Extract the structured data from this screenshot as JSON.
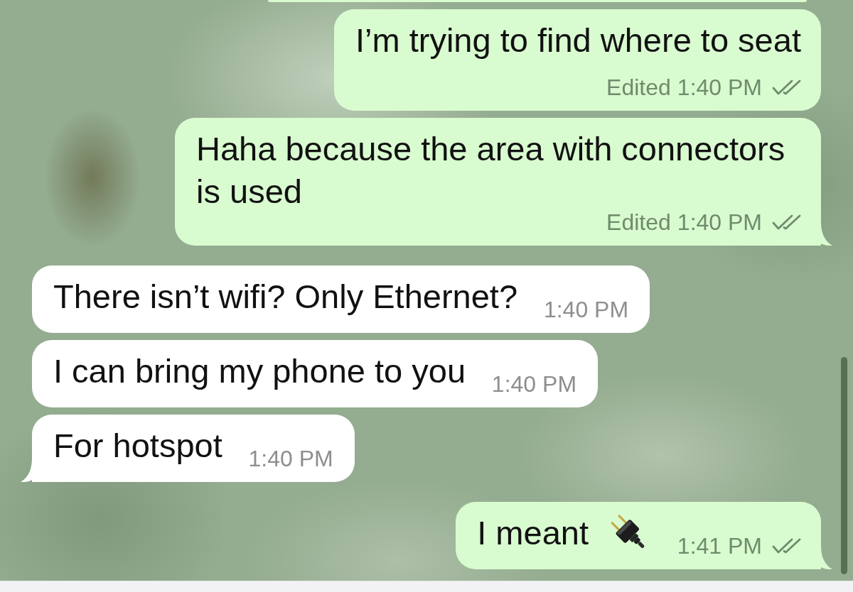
{
  "messages": [
    {
      "kind": "partial",
      "outgoing": true
    },
    {
      "kind": "text",
      "outgoing": true,
      "text": "I’m trying to find where to seat",
      "edited_label": "Edited",
      "time": "1:40 PM",
      "delivered": true,
      "tail": false
    },
    {
      "kind": "text",
      "outgoing": true,
      "text": "Haha because the area with connectors is used",
      "edited_label": "Edited",
      "time": "1:40 PM",
      "delivered": true,
      "tail": true
    },
    {
      "kind": "text",
      "outgoing": false,
      "text": "There isn’t wifi? Only Ethernet?",
      "time": "1:40 PM",
      "tail": false
    },
    {
      "kind": "text",
      "outgoing": false,
      "text": "I can bring my phone to you",
      "time": "1:40 PM",
      "tail": false
    },
    {
      "kind": "text",
      "outgoing": false,
      "text": "For hotspot",
      "time": "1:40 PM",
      "tail": true
    },
    {
      "kind": "text_icon",
      "outgoing": true,
      "text": "I meant",
      "time": "1:41 PM",
      "delivered": true,
      "tail": true
    }
  ]
}
